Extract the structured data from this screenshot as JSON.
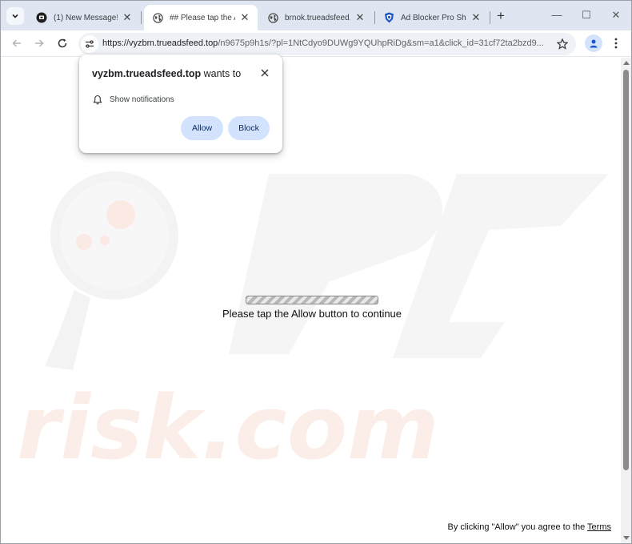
{
  "tabs": [
    {
      "title": "(1) New Message!",
      "icon": "message-icon",
      "active": false
    },
    {
      "title": "## Please tap the Allow",
      "icon": "globe-icon",
      "active": true
    },
    {
      "title": "brnok.trueadsfeed.top",
      "icon": "globe-icon",
      "active": false
    },
    {
      "title": "Ad Blocker Pro Shield",
      "icon": "shield-icon",
      "active": false
    }
  ],
  "newtab_label": "+",
  "window_controls": {
    "minimize": "—",
    "maximize": "☐",
    "close": "✕"
  },
  "address_bar": {
    "host": "https://vyzbm.trueadsfeed.top",
    "path": "/n9675p9h1s/?pl=1NtCdyo9DUWg9YQUhpRiDg&sm=a1&click_id=31cf72ta2bzd9..."
  },
  "permission_popup": {
    "site": "vyzbm.trueadsfeed.top",
    "suffix": "wants to",
    "permission": "Show notifications",
    "allow_label": "Allow",
    "block_label": "Block"
  },
  "page": {
    "message": "Please tap the Allow button to continue",
    "terms_prefix": "By clicking \"Allow\" you agree to the",
    "terms_link": "Terms"
  },
  "watermark": {
    "text": "risk.com"
  },
  "colors": {
    "tabstrip": "#dfe6f2",
    "omnibox": "#eef1f6",
    "button": "#d3e3fd",
    "watermark": "#f3f3f3",
    "watermark_accent": "#fbe9e4"
  }
}
